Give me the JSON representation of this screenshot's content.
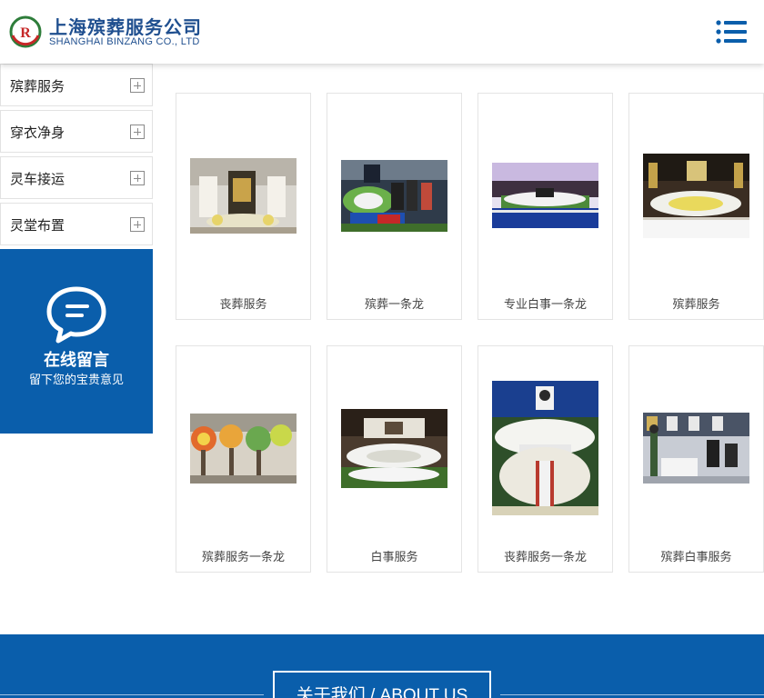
{
  "header": {
    "brand_cn": "上海殡葬服务公司",
    "brand_en": "SHANGHAI BINZANG CO., LTD"
  },
  "sidebar": {
    "items": [
      {
        "label": "殡葬服务"
      },
      {
        "label": "穿衣净身"
      },
      {
        "label": "灵车接运"
      },
      {
        "label": "灵堂布置"
      }
    ],
    "message": {
      "title": "在线留言",
      "subtitle": "留下您的宝贵意见"
    }
  },
  "products": [
    {
      "caption": "丧葬服务"
    },
    {
      "caption": "殡葬一条龙"
    },
    {
      "caption": "专业白事一条龙"
    },
    {
      "caption": "殡葬服务"
    },
    {
      "caption": "殡葬服务一条龙"
    },
    {
      "caption": "白事服务"
    },
    {
      "caption": "丧葬服务一条龙"
    },
    {
      "caption": "殡葬白事服务"
    }
  ],
  "footer": {
    "about_label": "关于我们 / ABOUT US"
  },
  "colors": {
    "brand_blue": "#0a5eab",
    "title_blue": "#1f4f8f"
  }
}
